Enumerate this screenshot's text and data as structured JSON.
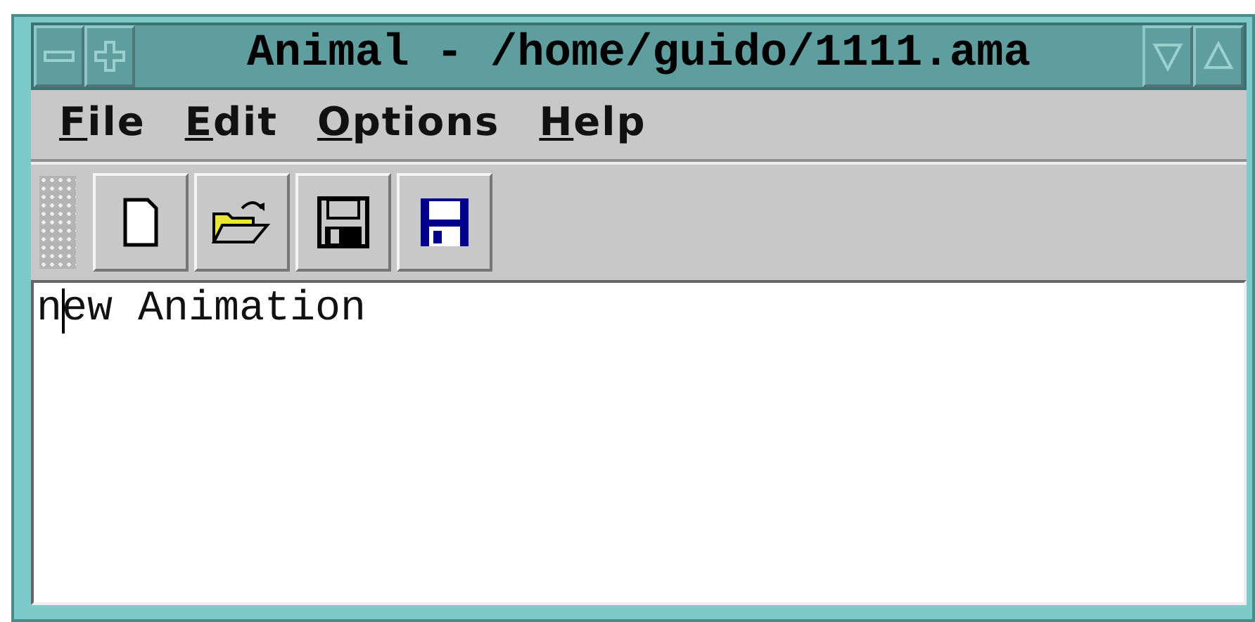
{
  "window": {
    "title": "Animal - /home/guido/1111.ama"
  },
  "menu": [
    {
      "label": "File"
    },
    {
      "label": "Edit"
    },
    {
      "label": "Options"
    },
    {
      "label": "Help"
    }
  ],
  "toolbar": [
    {
      "kind": "new"
    },
    {
      "kind": "open"
    },
    {
      "kind": "save"
    },
    {
      "kind": "save-as"
    }
  ],
  "editor": {
    "value": "new Animation"
  }
}
